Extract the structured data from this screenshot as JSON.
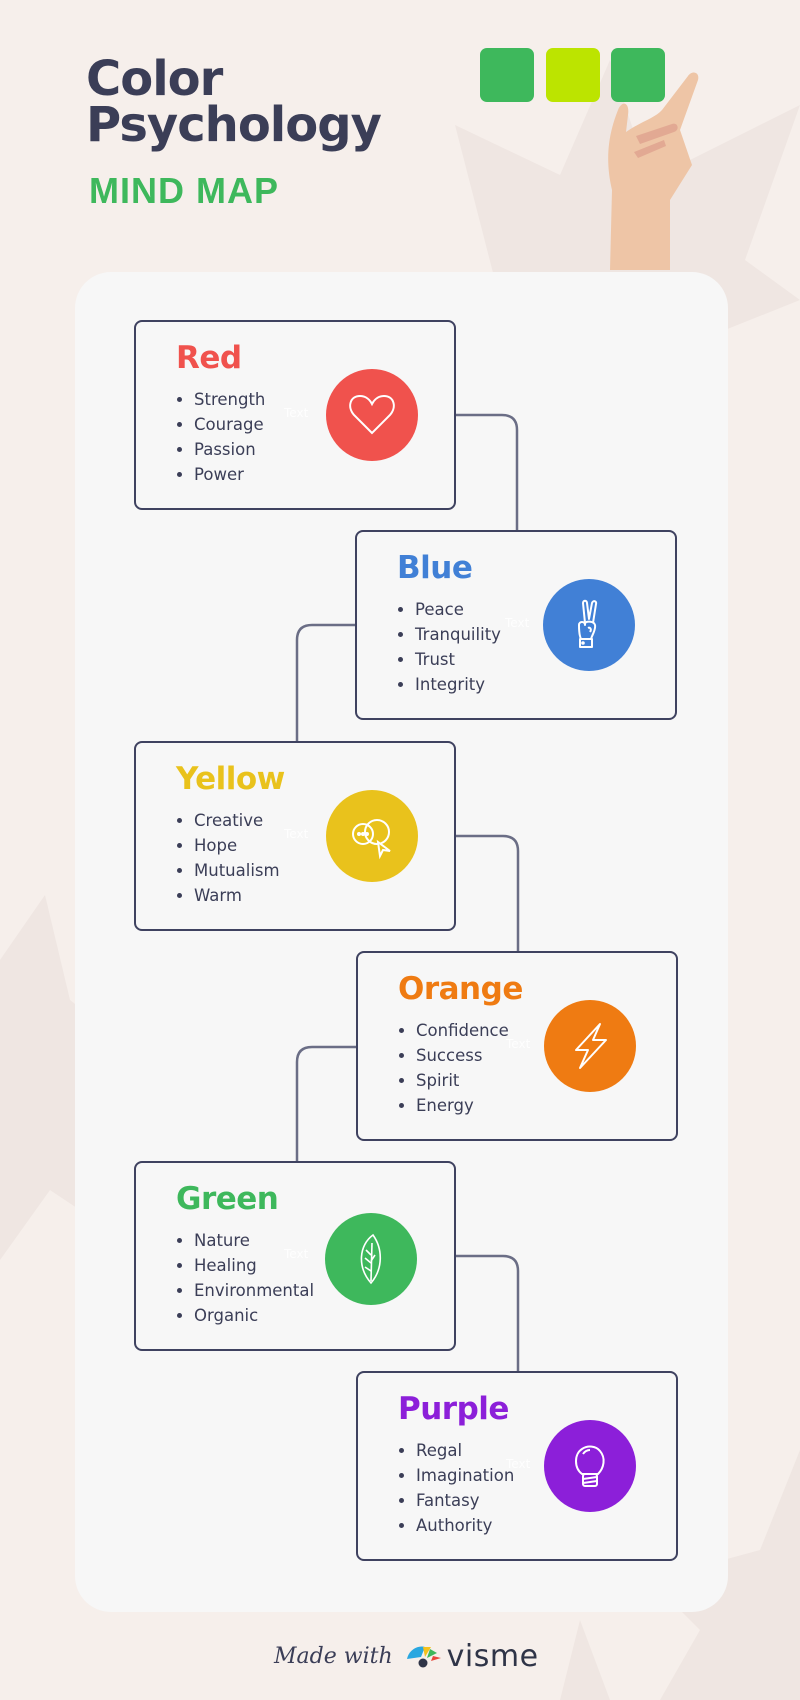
{
  "header": {
    "title_line1": "Color",
    "title_line2": "Psychology",
    "subtitle": "MIND MAP"
  },
  "swatches": [
    {
      "name": "green",
      "color": "#3eb85c"
    },
    {
      "name": "lime",
      "color": "#bce400"
    },
    {
      "name": "green",
      "color": "#3eb85c"
    }
  ],
  "colors": {
    "background": "#f6efeb",
    "panel": "#f7f7f7",
    "card_border": "#3f4260",
    "text_dark": "#3b3e57",
    "accent_green": "#3eb85c"
  },
  "cards": [
    {
      "title": "Red",
      "color": "#f0524d",
      "icon": "heart-icon",
      "items": [
        "Strength",
        "Courage",
        "Passion",
        "Power"
      ],
      "placeholder": "Text"
    },
    {
      "title": "Blue",
      "color": "#4180d6",
      "icon": "peace-hand-icon",
      "items": [
        "Peace",
        "Tranquility",
        "Trust",
        "Integrity"
      ],
      "placeholder": "Text"
    },
    {
      "title": "Yellow",
      "color": "#e9c21c",
      "icon": "chat-bubbles-icon",
      "items": [
        "Creative",
        "Hope",
        "Mutualism",
        "Warm"
      ],
      "placeholder": "Text"
    },
    {
      "title": "Orange",
      "color": "#ef7b12",
      "icon": "lightning-icon",
      "items": [
        "Confidence",
        "Success",
        "Spirit",
        "Energy"
      ],
      "placeholder": "Text"
    },
    {
      "title": "Green",
      "color": "#3eb85c",
      "icon": "leaf-icon",
      "items": [
        "Nature",
        "Healing",
        "Environmental",
        "Organic"
      ],
      "placeholder": "Text"
    },
    {
      "title": "Purple",
      "color": "#8c1fd9",
      "icon": "lightbulb-icon",
      "items": [
        "Regal",
        "Imagination",
        "Fantasy",
        "Authority"
      ],
      "placeholder": "Text"
    }
  ],
  "footer": {
    "made_with": "Made with",
    "brand": "visme"
  }
}
